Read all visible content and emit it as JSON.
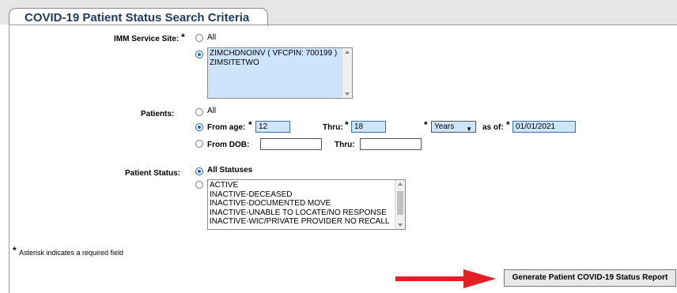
{
  "header": {
    "title": "COVID-19 Patient Status Search Criteria"
  },
  "service_site": {
    "label": "IMM Service Site:",
    "required_mark": "*",
    "all_option": "All",
    "list_items": [
      "ZIMCHDNOINV ( VFCPIN: 700199 )",
      "ZIMSITETWO"
    ]
  },
  "patients": {
    "label": "Patients:",
    "all_option": "All",
    "from_age_label": "From age:",
    "from_age_required": "*",
    "from_age_value": "12",
    "thru_label": "Thru:",
    "thru_required": "*",
    "thru_value": "18",
    "unit_required": "*",
    "unit_value": "Years",
    "as_of_label": "as of:",
    "as_of_required": "*",
    "as_of_value": "01/01/2021",
    "from_dob_label": "From DOB:",
    "from_dob_value": "",
    "dob_thru_label": "Thru:",
    "dob_thru_value": ""
  },
  "patient_status": {
    "label": "Patient Status:",
    "all_option": "All Statuses",
    "list_items": [
      "ACTIVE",
      "INACTIVE-DECEASED",
      "INACTIVE-DOCUMENTED MOVE",
      "INACTIVE-UNABLE TO LOCATE/NO RESPONSE",
      "INACTIVE-WIC/PRIVATE PROVIDER NO RECALL"
    ]
  },
  "footnote": {
    "mark": "*",
    "text": "Asterisk indicates a required field"
  },
  "actions": {
    "generate_label": "Generate Patient COVID-19 Status Report"
  },
  "colors": {
    "selected_bg": "#cde4fb",
    "header_text": "#1f3b63",
    "arrow": "#e31e24"
  }
}
